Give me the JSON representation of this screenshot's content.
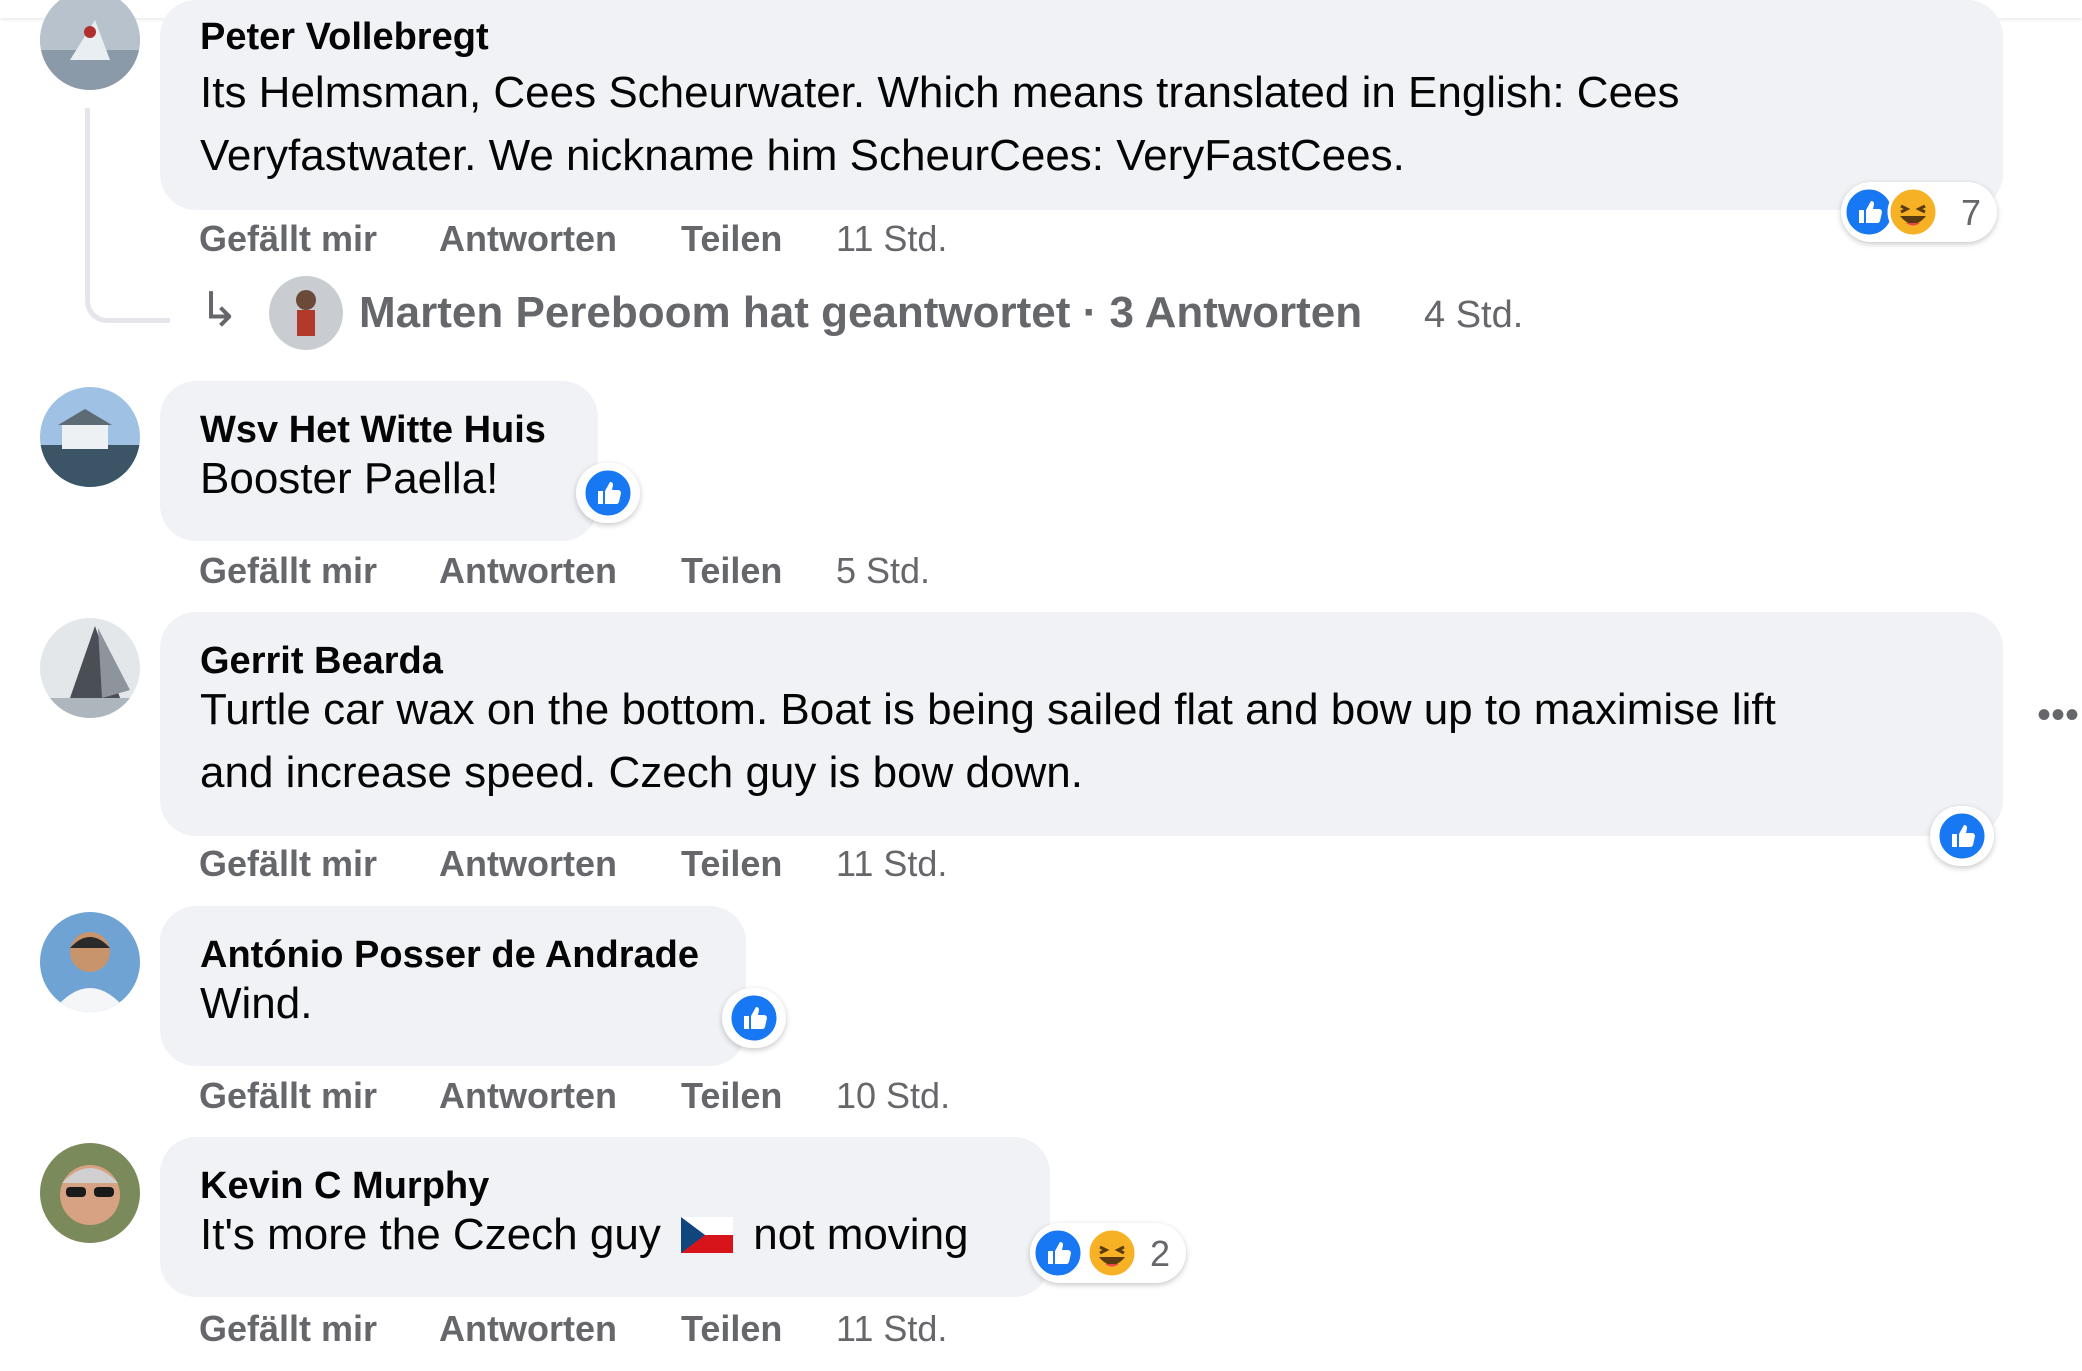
{
  "actions": {
    "like": "Gefällt mir",
    "reply": "Antworten",
    "share": "Teilen"
  },
  "colors": {
    "bubble": "#f0f2f5",
    "secondary_text": "#65676b",
    "like_blue": "#1877f2"
  },
  "comments": [
    {
      "author": "Peter Vollebregt",
      "lines": [
        "Its Helmsman, Cees Scheurwater. Which means translated in English: Cees",
        "Veryfastwater. We nickname him ScheurCees: VeryFastCees."
      ],
      "time": "11 Std.",
      "reactions": [
        "like-icon",
        "haha-icon"
      ],
      "reaction_count": "7"
    },
    {
      "author": "Wsv Het Witte Huis",
      "lines": [
        "Booster Paella!"
      ],
      "time": "5 Std.",
      "reactions": [
        "like-icon"
      ]
    },
    {
      "author": "Gerrit Bearda",
      "lines": [
        "Turtle car wax on the bottom. Boat is being sailed flat and bow up to maximise lift",
        "and increase speed. Czech guy is bow down."
      ],
      "time": "11 Std.",
      "reactions": [
        "like-icon"
      ]
    },
    {
      "author": "António Posser de Andrade",
      "lines": [
        "Wind."
      ],
      "time": "10 Std.",
      "reactions": [
        "like-icon"
      ]
    },
    {
      "author": "Kevin C Murphy",
      "text_before_flag": "It's more the Czech guy",
      "text_after_flag": "not moving",
      "flag_icon": "czech-flag-icon",
      "time": "11 Std.",
      "reactions": [
        "like-icon",
        "haha-icon"
      ],
      "reaction_count": "2"
    }
  ],
  "reply_summary": {
    "text": "Marten Pereboom hat geantwortet · 3 Antworten",
    "time": "4 Std."
  },
  "more_icon": "more-options-icon"
}
